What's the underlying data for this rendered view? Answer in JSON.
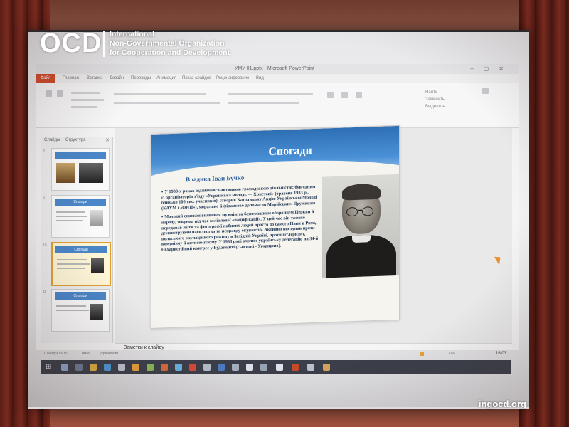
{
  "watermark": {
    "logo": "OCD",
    "org_line_1": "International",
    "org_line_2": "Non-Governmental Organization",
    "org_line_3": "for Cooperation and Development",
    "site": "ingocd.org"
  },
  "window": {
    "title": "УМУ 01.pptx - Microsoft PowerPoint",
    "file_tab": "Файл",
    "tabs": [
      "Главная",
      "Вставка",
      "Дизайн",
      "Переходы",
      "Анимация",
      "Показ слайдов",
      "Рецензирование",
      "Вид"
    ],
    "ribbon_right_1": "Найти",
    "ribbon_right_2": "Заменить",
    "ribbon_right_3": "Выделить"
  },
  "left_pane": {
    "tab_slides": "Слайды",
    "tab_outline": "Структура",
    "slot_numbers": [
      "8",
      "9",
      "10",
      "11"
    ],
    "thumb_titles": [
      "",
      "Спогади",
      "Спогади",
      "Спогади"
    ]
  },
  "slide": {
    "title": "Спогади",
    "subtitle": "Владика Іван Бучко",
    "paragraph_1": "У 1930-х роках відзначався активною громадською діяльністю: був одним із організаторів з'їзду «Українська молодь — Христові» (травень 1933 р., близько 100 тис. учасників), створив Католицьку Акцію Української Молоді (КАУМ і «ОРЛІ»), морально й фінансово допомагав Марійським Дружинам.",
    "paragraph_2": "Молодий єпископ виявився мужнім та безстрашним оборонцем Церкви й народу, зокрема під час осліпленої «пацифікації». У цей час він таємно передавав звіти та фотографії побитих людей просто до самого Папи в Римі, демонструючи насильство та неправду окупантів. Активно виступав проти польського окупаційного режиму в Західній Україні, проти гітлеризму, комунізму й антисемітизму. У 1938 році очолює українську делегацію на 34-й Євхаристійний конгрес у Будапешті (сьогодні - Угорщина)."
  },
  "notes": {
    "placeholder": "Заметки к слайду"
  },
  "statusbar": {
    "slide_info": "Слайд 9 из 15",
    "theme": "Тема",
    "language": "украинский",
    "zoom": "72%",
    "time": "16:03"
  },
  "colors": {
    "slide_header": "#2e6fb4",
    "slide_text": "#1e3556",
    "file_tab": "#d04a2a",
    "taskbar": "#3b3f4a"
  }
}
